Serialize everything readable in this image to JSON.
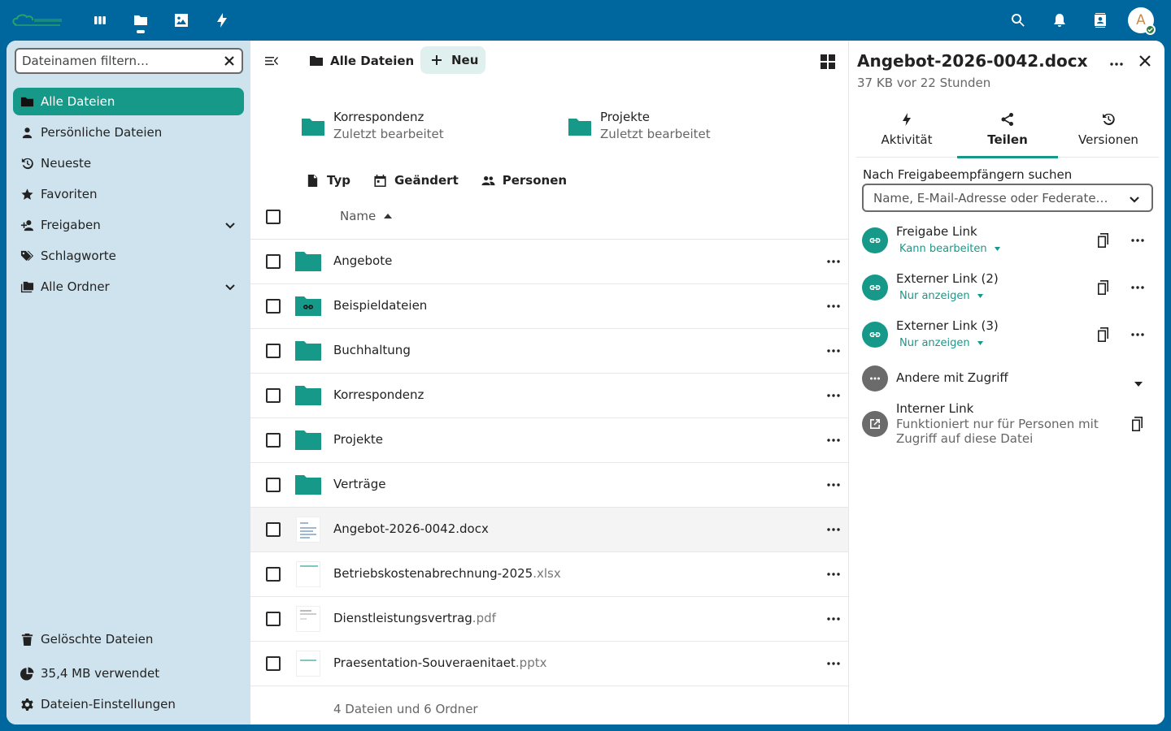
{
  "header": {
    "logo": "nextcloud-logo",
    "apps": [
      {
        "name": "dashboard-icon"
      },
      {
        "name": "files-icon",
        "active": true
      },
      {
        "name": "photos-icon"
      },
      {
        "name": "activity-icon"
      }
    ],
    "right_icons": [
      "search-icon",
      "bell-icon",
      "contacts-icon"
    ],
    "avatar_initial": "A"
  },
  "sidebar": {
    "filter_placeholder": "Dateinamen filtern…",
    "items": [
      {
        "label": "Alle Dateien",
        "icon": "folder-icon",
        "active": true
      },
      {
        "label": "Persönliche Dateien",
        "icon": "person-icon"
      },
      {
        "label": "Neueste",
        "icon": "history-icon"
      },
      {
        "label": "Favoriten",
        "icon": "star-icon"
      },
      {
        "label": "Freigaben",
        "icon": "share-person-icon",
        "expandable": true
      },
      {
        "label": "Schlagworte",
        "icon": "tag-icon"
      },
      {
        "label": "Alle Ordner",
        "icon": "folders-icon",
        "expandable": true
      }
    ],
    "footer": [
      {
        "label": "Gelöschte Dateien",
        "icon": "trash-icon"
      },
      {
        "label": "35,4 MB verwendet",
        "icon": "pie-chart-icon"
      },
      {
        "label": "Dateien-Einstellungen",
        "icon": "gear-icon"
      }
    ]
  },
  "main": {
    "breadcrumb": "Alle Dateien",
    "new_label": "Neu",
    "recent": [
      {
        "name": "Korrespondenz",
        "sub": "Zuletzt bearbeitet"
      },
      {
        "name": "Projekte",
        "sub": "Zuletzt bearbeitet"
      }
    ],
    "filters": [
      {
        "label": "Typ",
        "icon": "file-icon"
      },
      {
        "label": "Geändert",
        "icon": "calendar-icon"
      },
      {
        "label": "Personen",
        "icon": "people-icon"
      }
    ],
    "column_name": "Name",
    "rows": [
      {
        "name": "Angebote",
        "ext": "",
        "type": "folder"
      },
      {
        "name": "Beispieldateien",
        "ext": "",
        "type": "shared-folder"
      },
      {
        "name": "Buchhaltung",
        "ext": "",
        "type": "folder"
      },
      {
        "name": "Korrespondenz",
        "ext": "",
        "type": "folder"
      },
      {
        "name": "Projekte",
        "ext": "",
        "type": "folder"
      },
      {
        "name": "Verträge",
        "ext": "",
        "type": "folder"
      },
      {
        "name": "Angebot-2026-0042.docx",
        "ext": "",
        "type": "file",
        "selected": true
      },
      {
        "name": "Betriebskostenabrechnung-2025",
        "ext": ".xlsx",
        "type": "file"
      },
      {
        "name": "Dienstleistungsvertrag",
        "ext": ".pdf",
        "type": "file"
      },
      {
        "name": "Praesentation-Souveraenitaet",
        "ext": ".pptx",
        "type": "file"
      }
    ],
    "summary": "4 Dateien und 6 Ordner"
  },
  "details": {
    "title": "Angebot-2026-0042.docx",
    "subtitle": "37 KB vor 22 Stunden",
    "tabs": [
      {
        "label": "Aktivität",
        "icon": "activity-icon"
      },
      {
        "label": "Teilen",
        "icon": "share-icon",
        "active": true
      },
      {
        "label": "Versionen",
        "icon": "history-icon"
      }
    ],
    "search_label": "Nach Freigabeempfängern suchen",
    "search_placeholder": "Name, E-Mail-Adresse oder Federate…",
    "shares": [
      {
        "title": "Freigabe Link",
        "permission": "Kann bearbeiten"
      },
      {
        "title": "Externer Link (2)",
        "permission": "Nur anzeigen"
      },
      {
        "title": "Externer Link (3)",
        "permission": "Nur anzeigen"
      }
    ],
    "others_label": "Andere mit Zugriff",
    "internal": {
      "title": "Interner Link",
      "description": "Funktioniert nur für Personen mit Zugriff auf diese Datei"
    }
  },
  "colors": {
    "primary": "#00679e",
    "accent": "#17998a",
    "sidebar_bg": "#cfe3ee"
  }
}
